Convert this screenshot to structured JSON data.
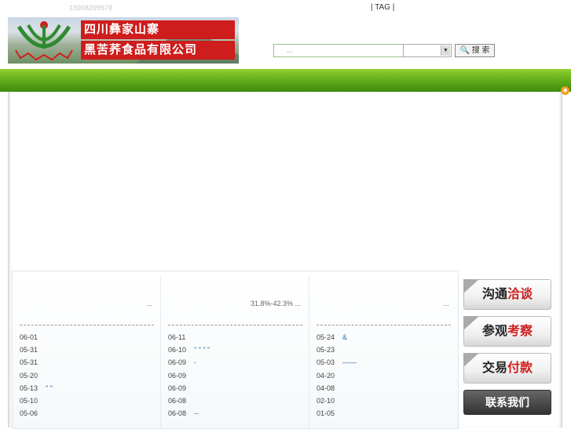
{
  "header": {
    "phone": "15008209578",
    "top_links": "| TAG |",
    "company_line1": "四川彝家山寨",
    "company_line2": "黑苦荞食品有限公司",
    "logo_text": "彝家山寨"
  },
  "search": {
    "placeholder": "...",
    "button": "🔍 搜 索"
  },
  "news": [
    {
      "head": "...",
      "items": [
        {
          "date": "06-01",
          "title": ""
        },
        {
          "date": "05-31",
          "title": ""
        },
        {
          "date": "05-31",
          "title": ""
        },
        {
          "date": "05-20",
          "title": ""
        },
        {
          "date": "05-13",
          "title": "\" \""
        },
        {
          "date": "05-10",
          "title": ""
        },
        {
          "date": "05-06",
          "title": ""
        }
      ]
    },
    {
      "head": "31.8%-42.3% ...",
      "items": [
        {
          "date": "06-11",
          "title": ""
        },
        {
          "date": "06-10",
          "title": "\" \" \" \""
        },
        {
          "date": "06-09",
          "title": "-"
        },
        {
          "date": "06-09",
          "title": ""
        },
        {
          "date": "06-09",
          "title": ""
        },
        {
          "date": "06-08",
          "title": ""
        },
        {
          "date": "06-08",
          "title": "--"
        }
      ]
    },
    {
      "head": "...",
      "items": [
        {
          "date": "05-24",
          "title": "&"
        },
        {
          "date": "05-23",
          "title": ""
        },
        {
          "date": "05-03",
          "title": "——"
        },
        {
          "date": "04-20",
          "title": ""
        },
        {
          "date": "04-08",
          "title": ""
        },
        {
          "date": "02-10",
          "title": ""
        },
        {
          "date": "01-05",
          "title": ""
        }
      ]
    }
  ],
  "side_buttons": [
    {
      "a": "沟通",
      "b": "洽谈"
    },
    {
      "a": "参观",
      "b": "考察"
    },
    {
      "a": "交易",
      "b": "付款"
    },
    {
      "a": "联系我们",
      "b": ""
    }
  ],
  "colors": {
    "green_bar": "#5ea919",
    "brand_red": "#cf1c1c",
    "link_blue": "#2a6db8"
  }
}
